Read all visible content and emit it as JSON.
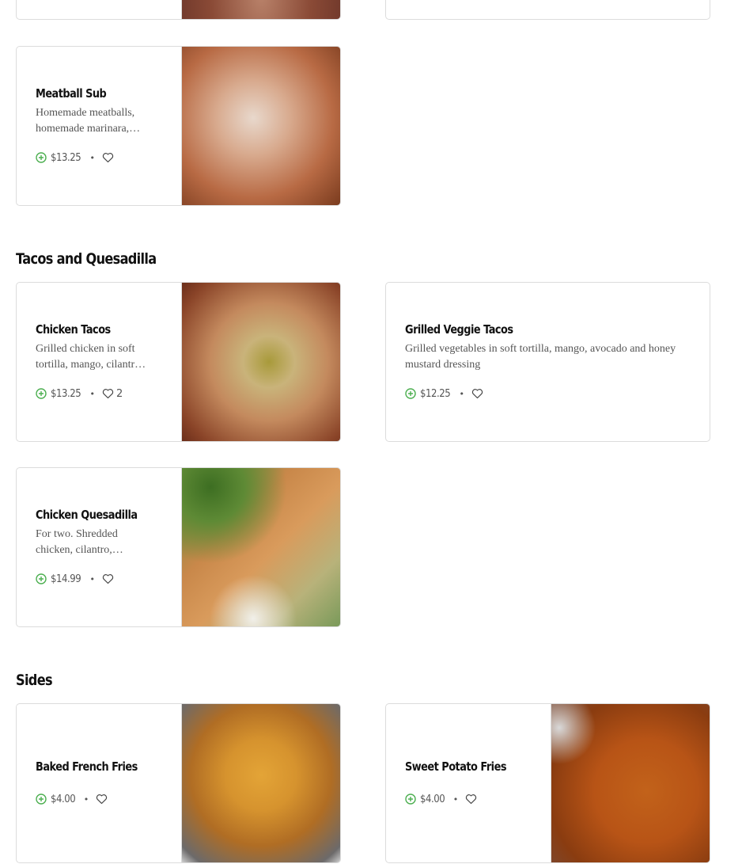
{
  "top_cards": {
    "left": {},
    "right": {}
  },
  "meatball_sub": {
    "name": "Meatball Sub",
    "description": "Homemade meatballs, homemade marinara,…",
    "price": "$13.25",
    "likes": ""
  },
  "sections": {
    "tacos": {
      "title": "Tacos and Quesadilla",
      "items": {
        "chicken_tacos": {
          "name": "Chicken Tacos",
          "description": "Grilled chicken in soft tortilla, mango, cilantr…",
          "price": "$13.25",
          "likes": "2"
        },
        "grilled_veggie_tacos": {
          "name": "Grilled Veggie Tacos",
          "description": "Grilled vegetables in soft tortilla, mango, avocado and honey mustard dressing",
          "price": "$12.25",
          "likes": ""
        },
        "chicken_quesadilla": {
          "name": "Chicken Quesadilla",
          "description": "For two. Shredded chicken, cilantro,…",
          "price": "$14.99",
          "likes": ""
        }
      }
    },
    "sides": {
      "title": "Sides",
      "items": {
        "baked_french_fries": {
          "name": "Baked French Fries",
          "price": "$4.00",
          "likes": ""
        },
        "sweet_potato_fries": {
          "name": "Sweet Potato Fries",
          "price": "$4.00",
          "likes": ""
        }
      }
    }
  },
  "icons": {
    "add": "add-to-cart-icon",
    "favorite": "heart-icon"
  },
  "colors": {
    "add_icon": "#4caf50",
    "border": "#dcdcdc",
    "text": "#111111",
    "muted": "#555555"
  }
}
